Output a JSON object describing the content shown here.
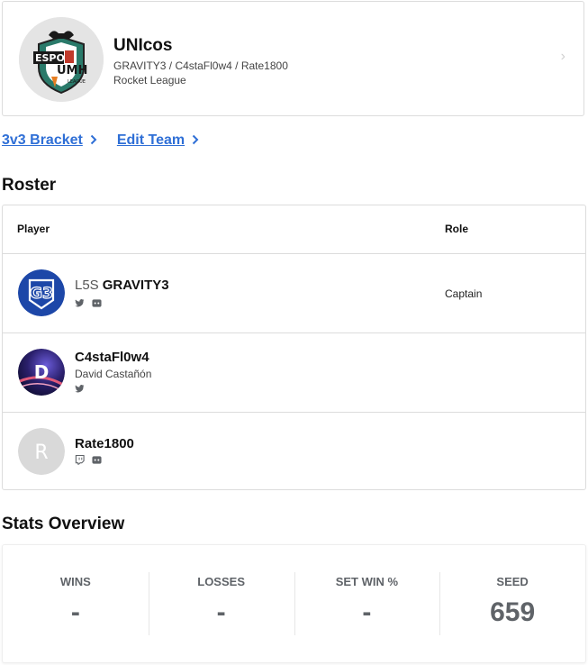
{
  "team": {
    "name": "UNIcos",
    "members_line": "GRAVITY3 / C4staFl0w4 / Rate1800",
    "game": "Rocket League",
    "logo_text": "ESPO UMH LEAGUE"
  },
  "links": [
    {
      "label": "3v3 Bracket"
    },
    {
      "label": "Edit Team"
    }
  ],
  "roster": {
    "title": "Roster",
    "columns": {
      "player": "Player",
      "role": "Role"
    },
    "players": [
      {
        "tag": "L5S",
        "name": "GRAVITY3",
        "real_name": "",
        "role": "Captain",
        "avatar": "G3",
        "socials": [
          "twitter-icon",
          "discord-icon"
        ]
      },
      {
        "tag": "",
        "name": "C4staFl0w4",
        "real_name": "David Castañón",
        "role": "",
        "avatar": "D",
        "socials": [
          "twitter-icon"
        ]
      },
      {
        "tag": "",
        "name": "Rate1800",
        "real_name": "",
        "role": "",
        "avatar": "R",
        "socials": [
          "twitch-icon",
          "discord-icon"
        ]
      }
    ]
  },
  "stats": {
    "title": "Stats Overview",
    "items": [
      {
        "label": "WINS",
        "value": "-"
      },
      {
        "label": "LOSSES",
        "value": "-"
      },
      {
        "label": "SET WIN %",
        "value": "-"
      },
      {
        "label": "SEED",
        "value": "659"
      }
    ]
  },
  "colors": {
    "link": "#2f6fd6",
    "border": "#dcdcdc",
    "stat_text": "#5f6368",
    "gravity_avatar": "#1d47a8"
  }
}
